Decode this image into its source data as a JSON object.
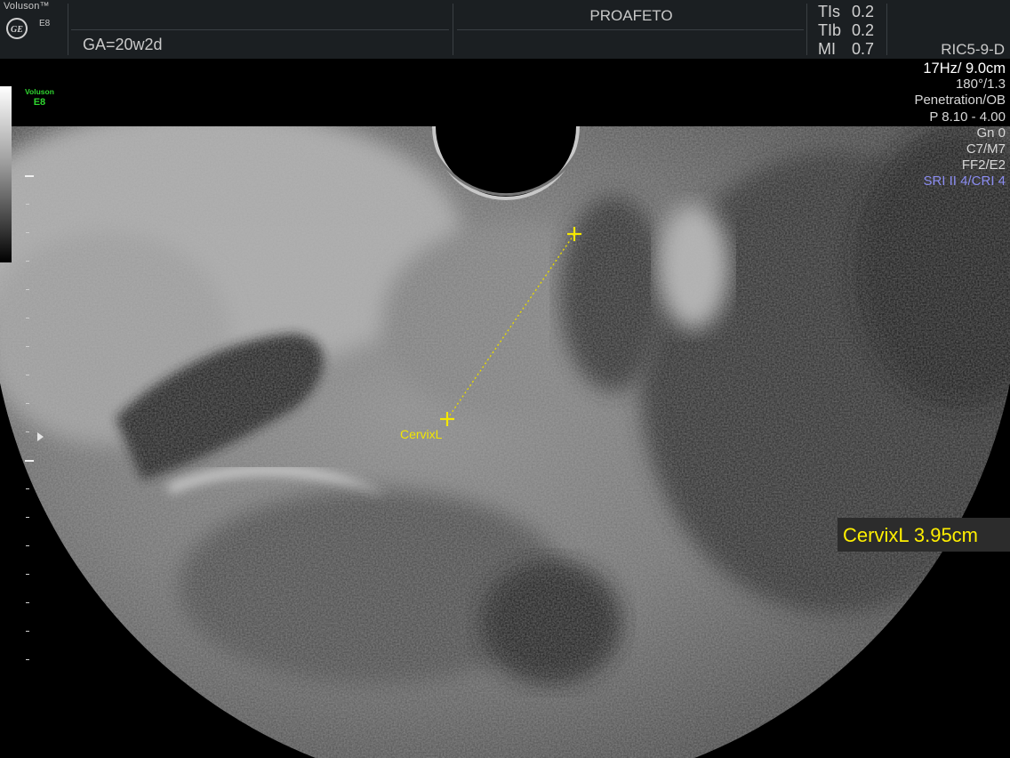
{
  "header": {
    "brand": "Voluson™",
    "model": "E8",
    "gestational_age": "GA=20w2d",
    "patient_name": "PROAFETO",
    "probe": "RIC5-9-D",
    "safety": [
      {
        "label": "TIs",
        "value": "0.2"
      },
      {
        "label": "TIb",
        "value": "0.2"
      },
      {
        "label": "MI",
        "value": "0.7"
      }
    ]
  },
  "params": {
    "frame_depth": "17Hz/ 9.0cm",
    "angle": "180°/1.3",
    "mode": "Penetration/OB",
    "power": "P 8.10 - 4.00",
    "gain": "Gn   0",
    "contrast": "C7/M7",
    "filter": "FF2/E2",
    "sri": "SRI II 4/CRI 4"
  },
  "overlay": {
    "voluson_small": "Voluson",
    "e8_small": "E8"
  },
  "measurement": {
    "label": "CervixL",
    "result_label": "CervixL",
    "value": "3.95",
    "unit": "cm",
    "result_text": "CervixL 3.95cm"
  },
  "colors": {
    "measurement": "#ffef00",
    "sri_text": "#8a8cf0",
    "voluson_tag": "#2fd52f",
    "header_bg": "#1b1f22"
  }
}
